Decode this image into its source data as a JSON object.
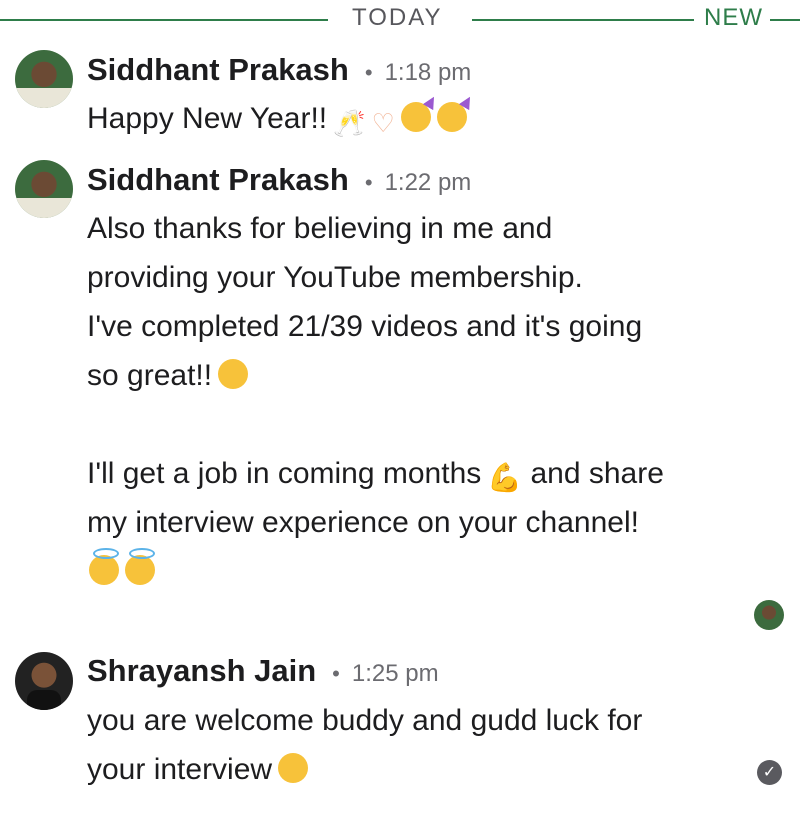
{
  "divider": {
    "today_label": "TODAY",
    "new_label": "NEW"
  },
  "messages": [
    {
      "author": "Siddhant Prakash",
      "time": "1:18 pm",
      "lines": [
        "Happy New Year!!"
      ],
      "avatar_badge": "OPENTOWORK"
    },
    {
      "author": "Siddhant Prakash",
      "time": "1:22 pm",
      "lines": [
        "Also thanks for believing in me and",
        "providing your YouTube membership.",
        "I've completed 21/39 videos and it's going",
        "so great!!",
        "",
        "I'll get a job in coming months",
        "my interview experience on your channel!"
      ],
      "line6_suffix": "and share",
      "avatar_badge": "OPENTOWORK"
    },
    {
      "author": "Shrayansh Jain",
      "time": "1:25 pm",
      "lines": [
        "you are welcome buddy and gudd luck for",
        "your interview"
      ]
    }
  ],
  "icons": {
    "msg1": [
      "clinking-glasses-icon",
      "heart-hands-icon",
      "partying-face-icon",
      "partying-face-icon"
    ],
    "msg2_line4": [
      "grinning-face-icon"
    ],
    "msg2_line6": [
      "flexed-biceps-icon"
    ],
    "msg2_line8": [
      "smiling-face-with-halo-icon",
      "smiling-face-with-halo-icon"
    ],
    "msg3": [
      "relieved-face-icon"
    ],
    "read_receipt": "read-receipt-avatar",
    "sent_check": "check-circle-icon"
  },
  "colors": {
    "accent_green": "#2e7d4a",
    "text": "#1d1d1f",
    "muted": "#6b6b70"
  }
}
